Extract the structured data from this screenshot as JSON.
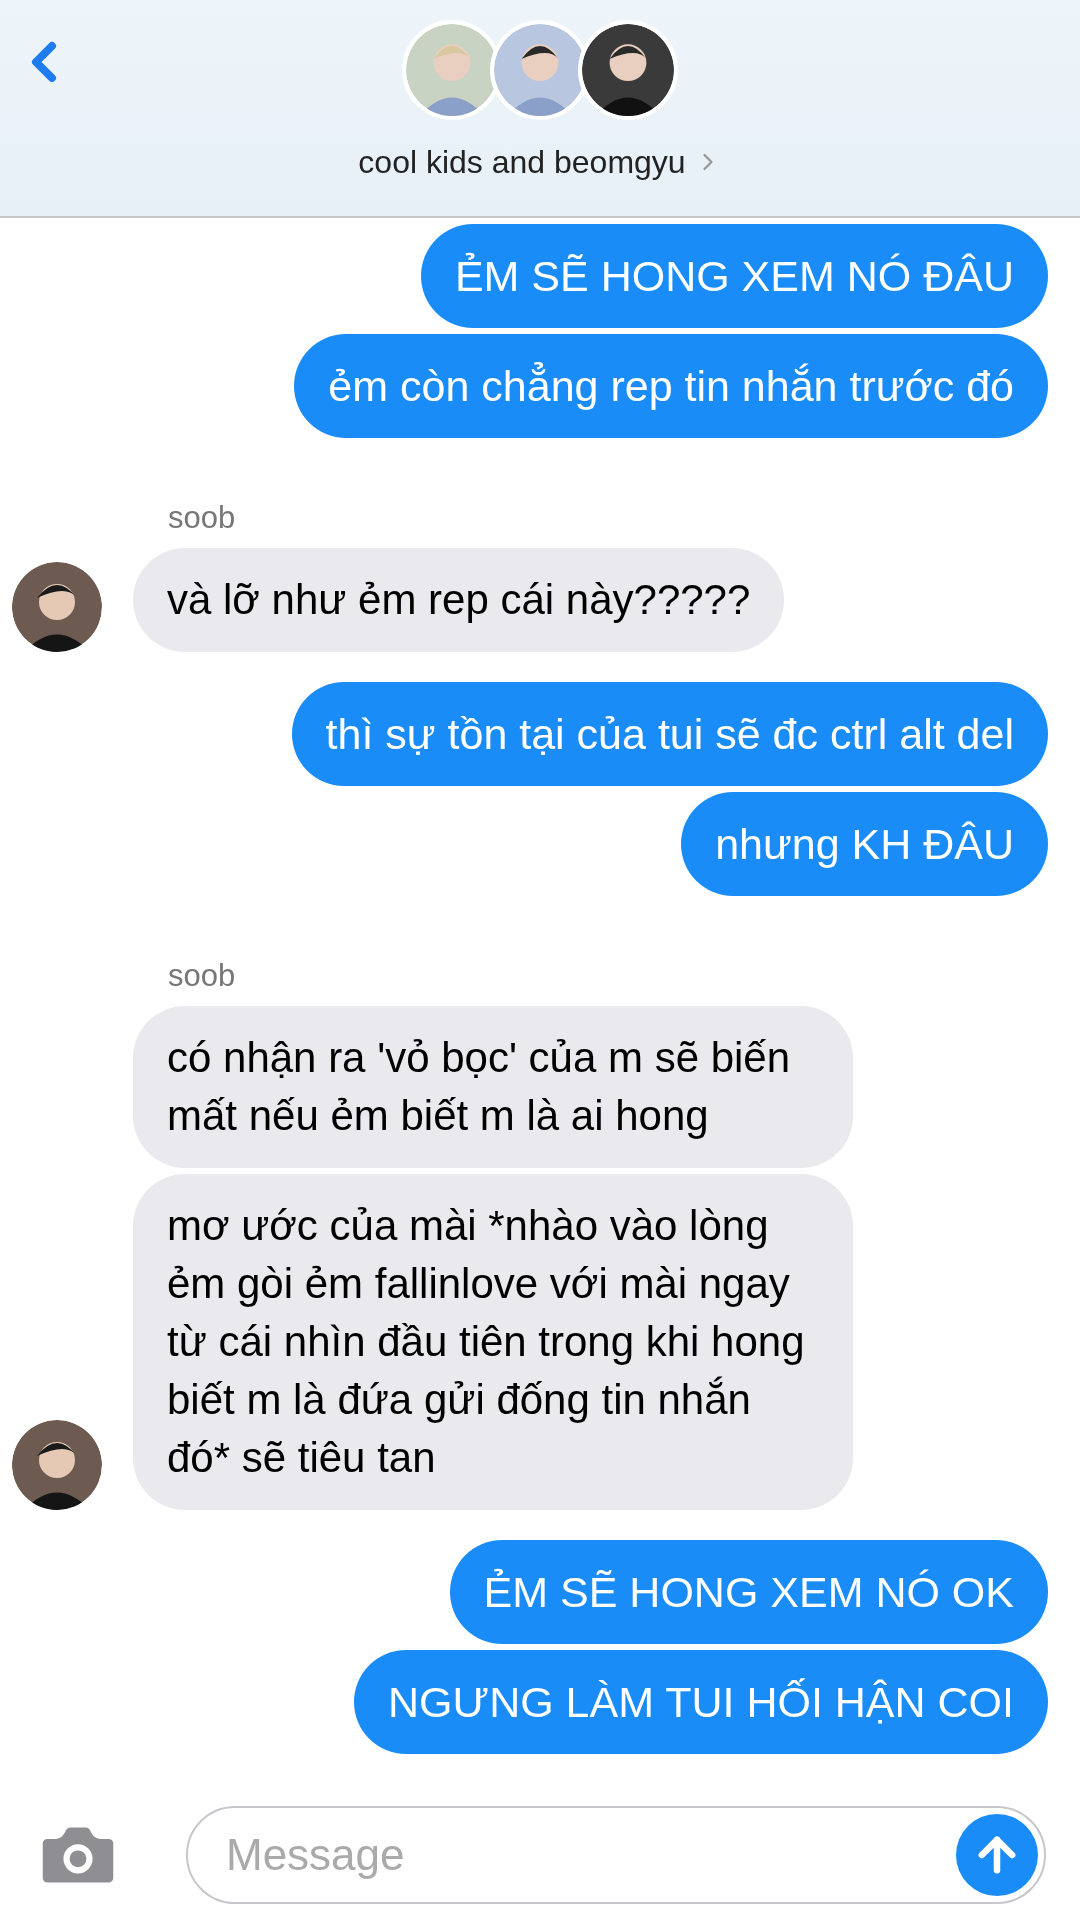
{
  "header": {
    "title": "cool kids and beomgyu"
  },
  "messages": [
    {
      "kind": "outgoing",
      "text": "ẺM SẼ HONG XEM NÓ ĐÂU"
    },
    {
      "kind": "outgoing",
      "text": "ẻm còn chẳng rep tin nhắn trước đó"
    },
    {
      "kind": "sender",
      "text": "soob"
    },
    {
      "kind": "incoming",
      "text": "và lỡ như ẻm rep cái này?????",
      "avatar": true
    },
    {
      "kind": "outgoing",
      "text": "thì sự tồn tại của tui sẽ đc ctrl alt del"
    },
    {
      "kind": "outgoing",
      "text": "nhưng KH ĐÂU"
    },
    {
      "kind": "sender",
      "text": "soob"
    },
    {
      "kind": "incoming",
      "text": "có nhận ra 'vỏ bọc' của m sẽ biến mất nếu ẻm biết m là ai hong",
      "avatar": false
    },
    {
      "kind": "incoming",
      "text": "mơ ước của mài *nhào vào lòng ẻm gòi ẻm fallinlove với mài ngay từ cái nhìn đầu tiên trong khi hong biết m là đứa gửi đống tin nhắn đó* sẽ tiêu tan",
      "avatar": true
    },
    {
      "kind": "outgoing",
      "text": "ẺM SẼ HONG XEM NÓ OK"
    },
    {
      "kind": "outgoing",
      "text": "NGƯNG LÀM TUI HỐI HẬN COI"
    }
  ],
  "composer": {
    "placeholder": "Message"
  }
}
